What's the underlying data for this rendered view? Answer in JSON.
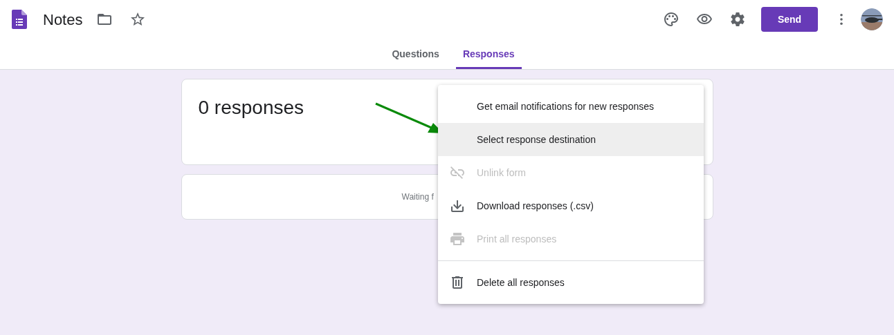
{
  "header": {
    "title": "Notes",
    "send_button": "Send"
  },
  "tabs": [
    {
      "label": "Questions",
      "selected": false
    },
    {
      "label": "Responses",
      "selected": true
    }
  ],
  "summary_card": {
    "title": "0 responses"
  },
  "status_card": {
    "text": "Waiting f"
  },
  "menu": {
    "groups": [
      [
        {
          "label": "Get email notifications for new responses",
          "disabled": false,
          "selected": false
        },
        {
          "label": "Select response destination",
          "disabled": false,
          "selected": true
        },
        {
          "label": "Unlink form",
          "disabled": true,
          "selected": false
        },
        {
          "label": "Download responses (.csv)",
          "disabled": false,
          "selected": false
        },
        {
          "label": "Print all responses",
          "disabled": true,
          "selected": false
        }
      ],
      [
        {
          "label": "Delete all responses",
          "disabled": false,
          "selected": false
        }
      ]
    ]
  }
}
